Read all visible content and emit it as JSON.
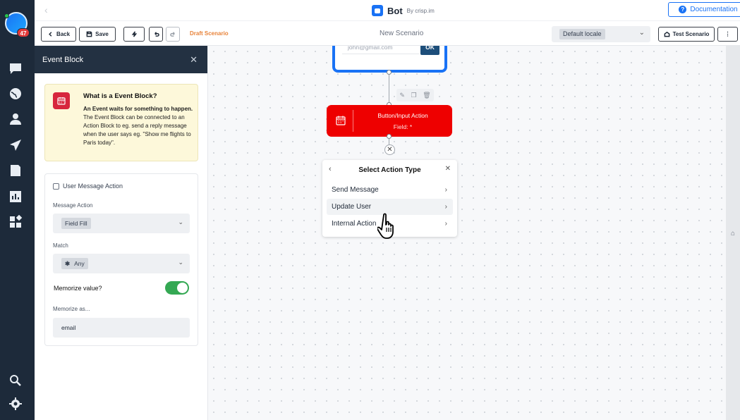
{
  "sidebar": {
    "badge_count": "47",
    "icons": [
      "chat-icon",
      "globe-icon",
      "user-icon",
      "send-icon",
      "book-icon",
      "analytics-icon",
      "plugins-icon",
      "search-icon",
      "gear-icon"
    ]
  },
  "topbar": {
    "app_name": "Bot",
    "app_by": "By crisp.im",
    "documentation_label": "Documentation"
  },
  "toolbar": {
    "back_label": "Back",
    "save_label": "Save",
    "status": "Draft Scenario",
    "scenario_name": "New Scenario",
    "locale_value": "Default locale",
    "test_label": "Test Scenario",
    "more_label": "⋮"
  },
  "panel": {
    "title": "Event Block",
    "info_title": "What is a Event Block?",
    "info_bold": "An Event waits for something to happen.",
    "info_text": " The Event Block can be connected to an Action Block to eg. send a reply message when the user says eg. \"Show me flights to Paris today\".",
    "section_title": "User Message Action",
    "message_action_label": "Message Action",
    "message_action_value": "Field Fill",
    "match_label": "Match",
    "match_value": "Any",
    "memorize_label": "Memorize value?",
    "memorize_enabled": true,
    "memorize_as_label": "Memorize as...",
    "memorize_as_value": "email"
  },
  "canvas": {
    "email_placeholder": "john@gmail.com",
    "ok_label": "OK",
    "node_title": "Button/Input Action",
    "node_field": "Field: *",
    "action_card": {
      "title": "Select Action Type",
      "items": [
        "Send Message",
        "Update User",
        "Internal Action"
      ]
    }
  },
  "colors": {
    "nav_bg": "#1d2a3a",
    "accent": "#1972f5",
    "node_red": "#ee0000",
    "draft_orange": "#e8833a",
    "toggle_green": "#34a853"
  }
}
